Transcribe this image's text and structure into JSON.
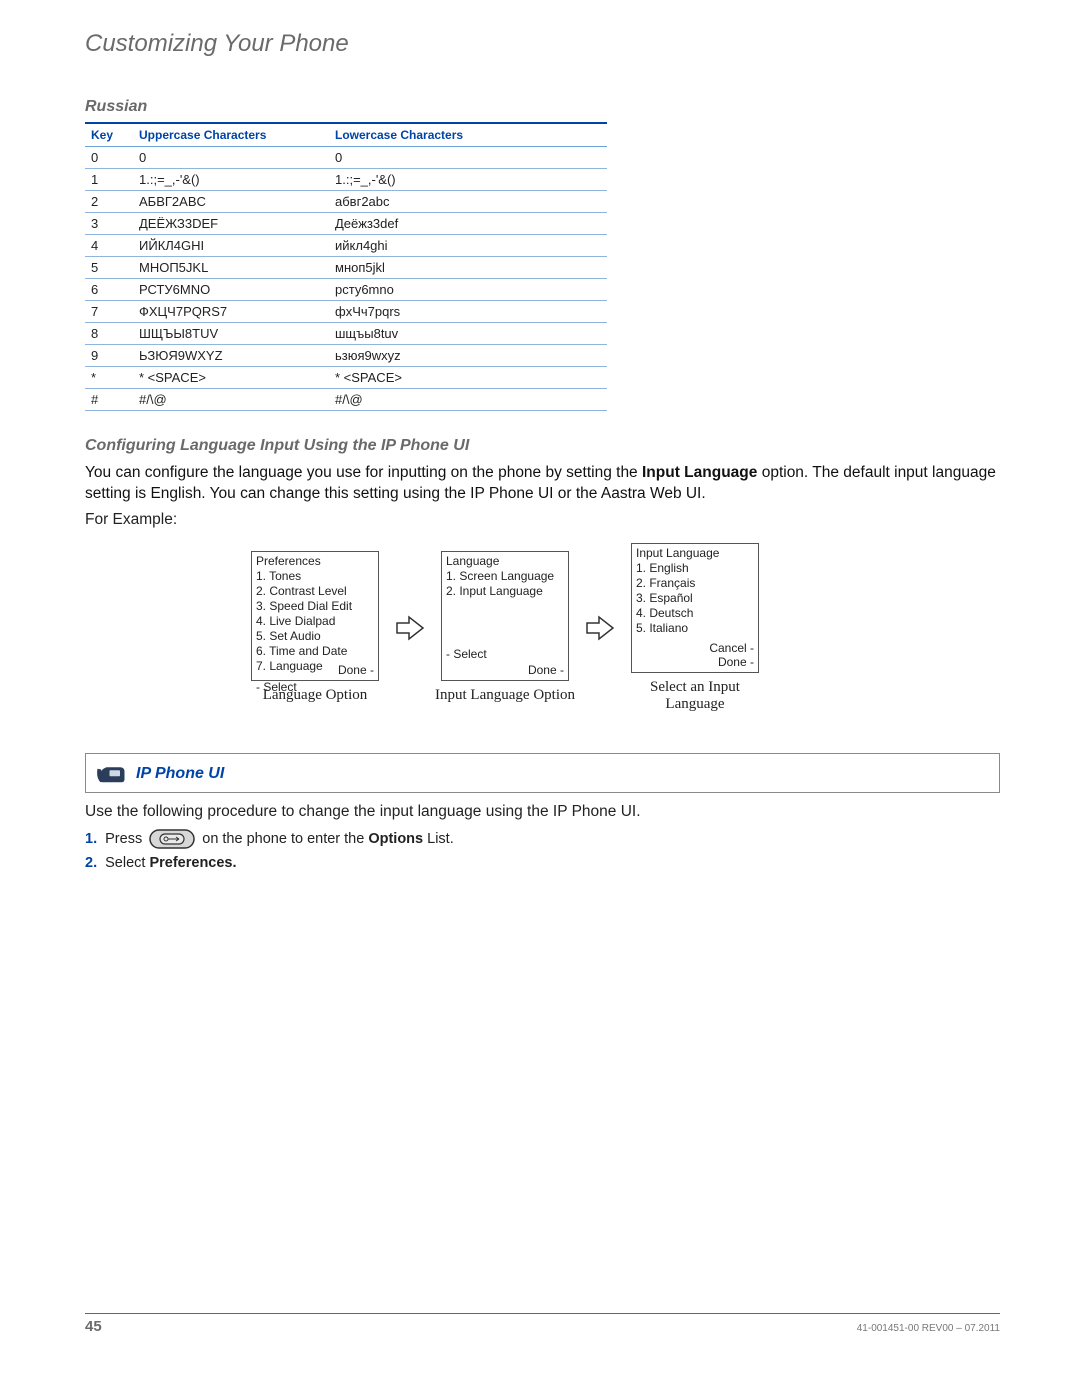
{
  "chapter_title": "Customizing Your Phone",
  "section_russian": "Russian",
  "table": {
    "headers": [
      "Key",
      "Uppercase Characters",
      "Lowercase Characters"
    ],
    "rows": [
      [
        "0",
        "0",
        "0"
      ],
      [
        "1",
        "1.:;=_,-'&()",
        "1.:;=_,-'&()"
      ],
      [
        "2",
        "АБВГ2ABC",
        "абвг2abc"
      ],
      [
        "3",
        "ДЕЁЖЗ3DEF",
        "Деёжз3def"
      ],
      [
        "4",
        "ИЙКЛ4GHI",
        "ийкл4ghi"
      ],
      [
        "5",
        "МНОП5JKL",
        "мноп5jkl"
      ],
      [
        "6",
        "РСТУ6MNO",
        "рсту6mno"
      ],
      [
        "7",
        "ФХЦЧ7PQRS7",
        "фхЧч7pqrs"
      ],
      [
        "8",
        "ШЩЪЫ8TUV",
        "шщъы8tuv"
      ],
      [
        "9",
        "ЬЗЮЯ9WXYZ",
        "ьзюя9wxyz"
      ],
      [
        "*",
        "* <SPACE>",
        "* <SPACE>"
      ],
      [
        "#",
        "#/\\@",
        "#/\\@"
      ]
    ]
  },
  "subsection_config": "Configuring Language Input Using the IP Phone UI",
  "config_para_1a": "You can configure the language you use for inputting on the phone by setting the ",
  "config_para_1b": "Input Language",
  "config_para_1c": " option. The default input language setting is English. You can change this setting using the IP Phone UI or the Aastra Web UI.",
  "for_example": "For Example:",
  "flow": {
    "box1": {
      "title": "Preferences",
      "items": [
        "1. Tones",
        "2. Contrast Level",
        "3. Speed Dial Edit",
        "4. Live Dialpad",
        "5. Set Audio",
        "6. Time and Date",
        "7. Language"
      ],
      "left": "- Select",
      "right": "Done -",
      "caption": "Language Option"
    },
    "box2": {
      "title": "Language",
      "items": [
        "1. Screen Language",
        "2. Input Language"
      ],
      "left": "- Select",
      "right": "Done -",
      "caption": "Input Language Option"
    },
    "box3": {
      "title": "Input Language",
      "items": [
        "1. English",
        "2. Français",
        "3. Español",
        "4. Deutsch",
        "5. Italiano"
      ],
      "right1": "Cancel -",
      "right2": "Done -",
      "caption": "Select an Input Language"
    }
  },
  "ui_box_title": "IP Phone UI",
  "instr_text": "Use the following procedure to change the input language using the IP Phone UI.",
  "steps": {
    "s1_num": "1.",
    "s1_a": "Press ",
    "s1_b": " on the phone to enter the ",
    "s1_c": "Options",
    "s1_d": " List.",
    "s2_num": "2.",
    "s2_a": "Select ",
    "s2_b": "Preferences."
  },
  "footer": {
    "page": "45",
    "rev": "41-001451-00 REV00 – 07.2011"
  }
}
